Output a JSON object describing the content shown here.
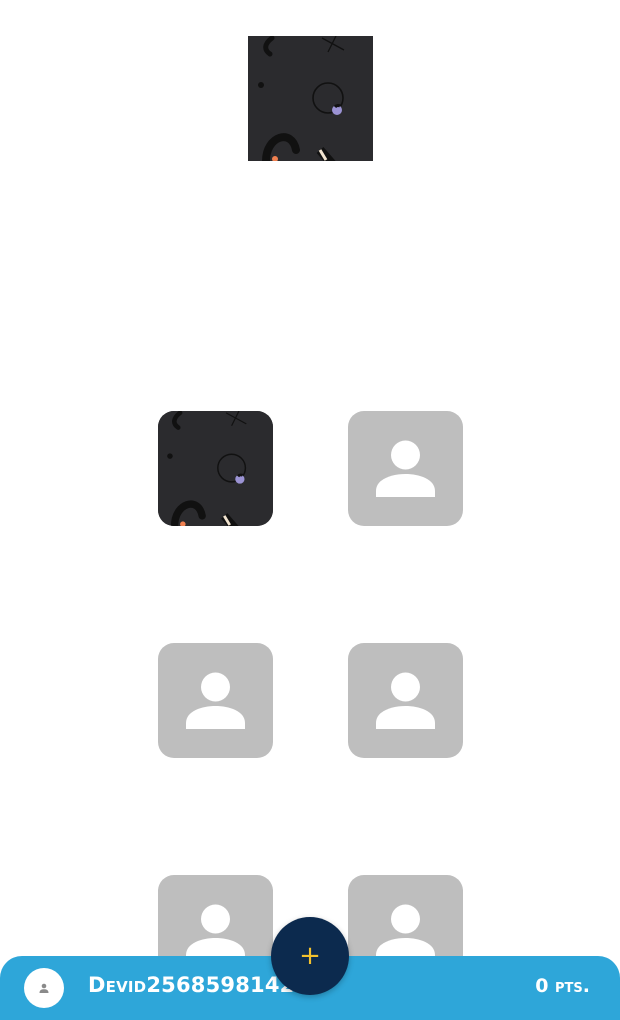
{
  "colors": {
    "bar": "#2ea6d9",
    "fab": "#0c2a4e",
    "fab_icon": "#f2c12e",
    "placeholder": "#bebebe",
    "pattern_bg": "#2b2b2e"
  },
  "hero": {
    "icon": "abstract-pattern-image"
  },
  "slots": [
    {
      "state": "filled",
      "icon": "abstract-pattern-image"
    },
    {
      "state": "empty",
      "icon": "person-placeholder-icon"
    },
    {
      "state": "empty",
      "icon": "person-placeholder-icon"
    },
    {
      "state": "empty",
      "icon": "person-placeholder-icon"
    },
    {
      "state": "empty",
      "icon": "person-placeholder-icon"
    },
    {
      "state": "empty",
      "icon": "person-placeholder-icon"
    }
  ],
  "fab": {
    "label": "+"
  },
  "user": {
    "name": "Devid25685981424",
    "points": "0 pts."
  }
}
